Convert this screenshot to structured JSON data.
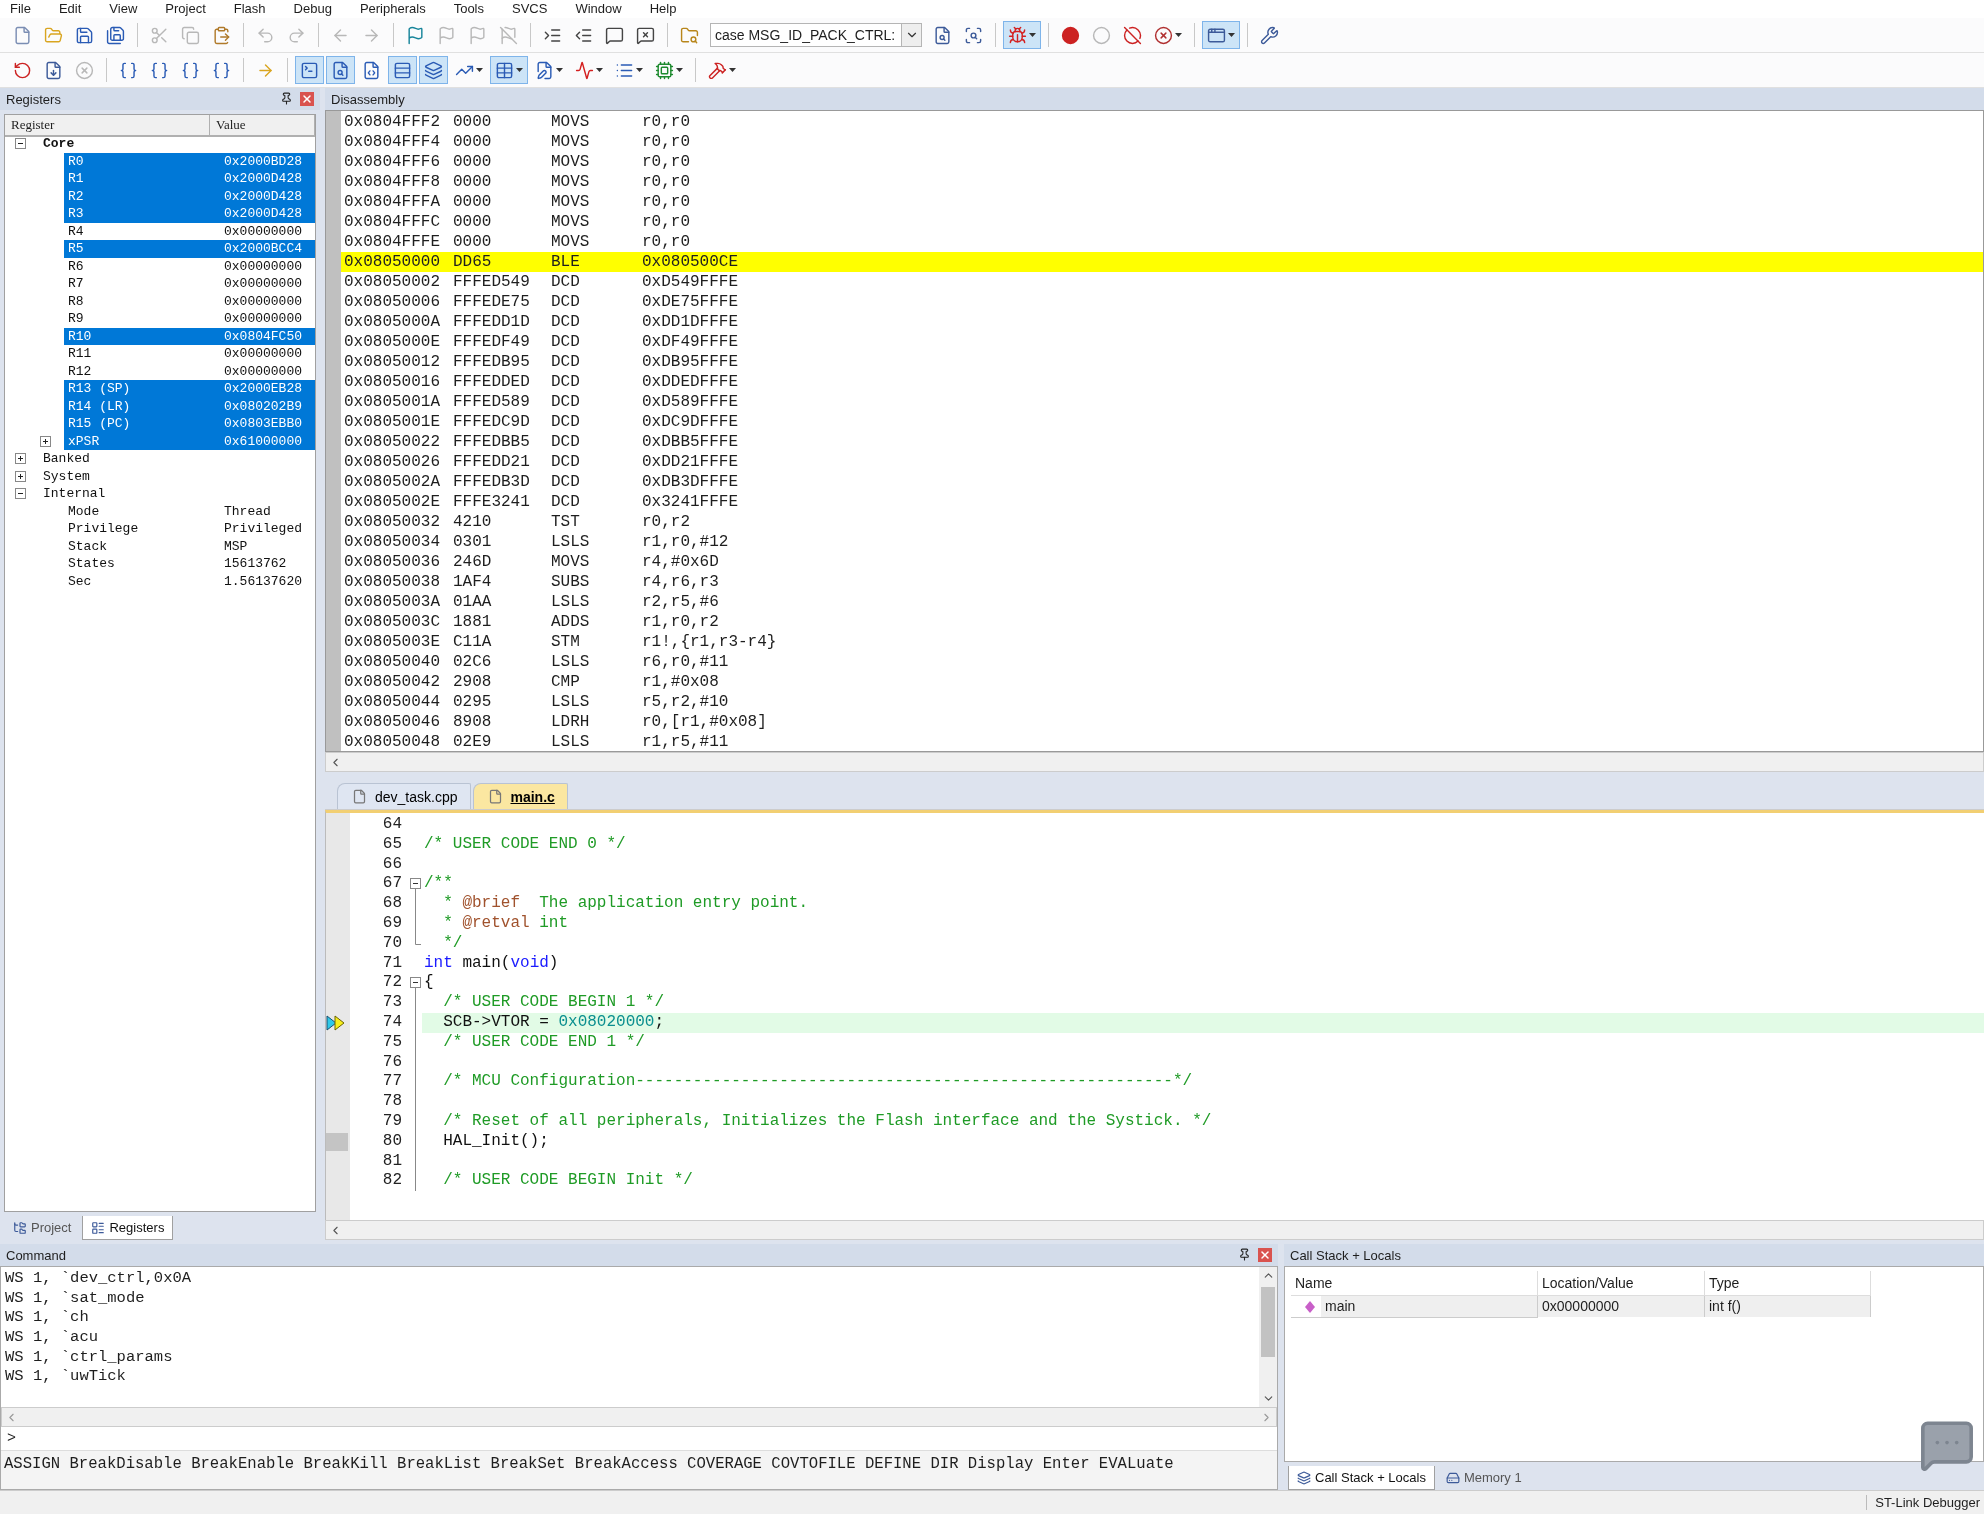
{
  "menu": [
    "File",
    "Edit",
    "View",
    "Project",
    "Flash",
    "Debug",
    "Peripherals",
    "Tools",
    "SVCS",
    "Window",
    "Help"
  ],
  "toolbars": [
    [
      {
        "kind": "newfile",
        "on": false,
        "disabled": false
      },
      {
        "kind": "open",
        "on": false,
        "disabled": false
      },
      {
        "kind": "save",
        "on": false,
        "disabled": false
      },
      {
        "kind": "saveall",
        "on": false,
        "disabled": false
      },
      {
        "kind": "separator"
      },
      {
        "kind": "cut",
        "on": false,
        "disabled": true
      },
      {
        "kind": "copy",
        "on": false,
        "disabled": true
      },
      {
        "kind": "paste",
        "on": false,
        "disabled": false
      },
      {
        "kind": "separator"
      },
      {
        "kind": "undo",
        "on": false,
        "disabled": true
      },
      {
        "kind": "redo",
        "on": false,
        "disabled": true
      },
      {
        "kind": "separator"
      },
      {
        "kind": "back",
        "on": false,
        "disabled": true
      },
      {
        "kind": "forward",
        "on": false,
        "disabled": true
      },
      {
        "kind": "separator"
      },
      {
        "kind": "bookmark",
        "on": false,
        "disabled": false
      },
      {
        "kind": "prevbookmark",
        "on": false,
        "disabled": true
      },
      {
        "kind": "nextbookmark",
        "on": false,
        "disabled": true
      },
      {
        "kind": "clearbookmarks",
        "on": false,
        "disabled": true
      },
      {
        "kind": "separator"
      },
      {
        "kind": "indent",
        "on": false,
        "disabled": false
      },
      {
        "kind": "unindent",
        "on": false,
        "disabled": false
      },
      {
        "kind": "comment",
        "on": false,
        "disabled": false
      },
      {
        "kind": "uncomment",
        "on": false,
        "disabled": false
      },
      {
        "kind": "separator"
      },
      {
        "kind": "findinfiles",
        "on": false,
        "disabled": false
      },
      {
        "kind": "combo",
        "value": "case MSG_ID_PACK_CTRL:"
      },
      {
        "kind": "find",
        "on": false,
        "disabled": false
      },
      {
        "kind": "incfind",
        "on": false,
        "disabled": false
      },
      {
        "kind": "separator"
      },
      {
        "kind": "debug",
        "on": true,
        "disabled": false,
        "dropdown": true
      },
      {
        "kind": "separator"
      },
      {
        "kind": "breakpoint",
        "on": false,
        "disabled": false
      },
      {
        "kind": "enablebp",
        "on": false,
        "disabled": true
      },
      {
        "kind": "disablebp",
        "on": false,
        "disabled": false
      },
      {
        "kind": "killbp",
        "on": false,
        "disabled": false,
        "dropdown": true
      },
      {
        "kind": "separator"
      },
      {
        "kind": "windows",
        "on": true,
        "disabled": false,
        "dropdown": true
      },
      {
        "kind": "separator"
      },
      {
        "kind": "configure",
        "on": false,
        "disabled": false
      }
    ],
    [
      {
        "kind": "reset",
        "on": false,
        "disabled": false
      },
      {
        "kind": "run",
        "on": false,
        "disabled": false
      },
      {
        "kind": "stop",
        "on": false,
        "disabled": true
      },
      {
        "kind": "separator"
      },
      {
        "kind": "stepinto",
        "on": false,
        "disabled": false
      },
      {
        "kind": "stepover",
        "on": false,
        "disabled": false
      },
      {
        "kind": "stepout",
        "on": false,
        "disabled": false
      },
      {
        "kind": "runtocursor",
        "on": false,
        "disabled": false
      },
      {
        "kind": "separator"
      },
      {
        "kind": "shownext",
        "on": false,
        "disabled": false
      },
      {
        "kind": "separator"
      },
      {
        "kind": "commandwin",
        "on": true,
        "disabled": false
      },
      {
        "kind": "disasmwin",
        "on": true,
        "disabled": false
      },
      {
        "kind": "symbols",
        "on": false,
        "disabled": false
      },
      {
        "kind": "registerswin",
        "on": true,
        "disabled": false
      },
      {
        "kind": "callstackwin",
        "on": true,
        "disabled": false
      },
      {
        "kind": "watch",
        "on": false,
        "disabled": false,
        "dropdown": true
      },
      {
        "kind": "memory",
        "on": true,
        "disabled": false,
        "dropdown": true
      },
      {
        "kind": "serial",
        "on": false,
        "disabled": false,
        "dropdown": true
      },
      {
        "kind": "analysis",
        "on": false,
        "disabled": false,
        "dropdown": true
      },
      {
        "kind": "trace",
        "on": false,
        "disabled": false,
        "dropdown": true
      },
      {
        "kind": "sysviewer",
        "on": false,
        "disabled": false,
        "dropdown": true
      },
      {
        "kind": "separator"
      },
      {
        "kind": "toolbox",
        "on": false,
        "disabled": false,
        "dropdown": true
      }
    ]
  ],
  "registers": {
    "title": "Registers",
    "columns": [
      "Register",
      "Value"
    ],
    "tree": [
      {
        "name": "Core",
        "bold": true,
        "expanded": true,
        "selected": false,
        "children": [
          {
            "name": "R0",
            "value": "0x2000BD28",
            "selected": true
          },
          {
            "name": "R1",
            "value": "0x2000D428",
            "selected": true
          },
          {
            "name": "R2",
            "value": "0x2000D428",
            "selected": true
          },
          {
            "name": "R3",
            "value": "0x2000D428",
            "selected": true
          },
          {
            "name": "R4",
            "value": "0x00000000",
            "selected": false
          },
          {
            "name": "R5",
            "value": "0x2000BCC4",
            "selected": true
          },
          {
            "name": "R6",
            "value": "0x00000000",
            "selected": false
          },
          {
            "name": "R7",
            "value": "0x00000000",
            "selected": false
          },
          {
            "name": "R8",
            "value": "0x00000000",
            "selected": false
          },
          {
            "name": "R9",
            "value": "0x00000000",
            "selected": false
          },
          {
            "name": "R10",
            "value": "0x0804FC50",
            "selected": true
          },
          {
            "name": "R11",
            "value": "0x00000000",
            "selected": false
          },
          {
            "name": "R12",
            "value": "0x00000000",
            "selected": false
          },
          {
            "name": "R13 (SP)",
            "value": "0x2000EB28",
            "selected": true
          },
          {
            "name": "R14 (LR)",
            "value": "0x080202B9",
            "selected": true
          },
          {
            "name": "R15 (PC)",
            "value": "0x0803EBB0",
            "selected": true
          },
          {
            "name": "xPSR",
            "value": "0x61000000",
            "selected": true,
            "expanded": false
          }
        ]
      },
      {
        "name": "Banked",
        "bold": false,
        "expanded": false,
        "selected": false
      },
      {
        "name": "System",
        "bold": false,
        "expanded": false,
        "selected": false
      },
      {
        "name": "Internal",
        "bold": false,
        "expanded": true,
        "selected": false,
        "children": [
          {
            "name": "Mode",
            "value": "Thread",
            "selected": false
          },
          {
            "name": "Privilege",
            "value": "Privileged",
            "selected": false
          },
          {
            "name": "Stack",
            "value": "MSP",
            "selected": false
          },
          {
            "name": "States",
            "value": "15613762",
            "selected": false
          },
          {
            "name": "Sec",
            "value": "1.56137620",
            "selected": false
          }
        ]
      }
    ]
  },
  "left_tabs": [
    {
      "label": "Project",
      "selected": false
    },
    {
      "label": "Registers",
      "selected": true
    }
  ],
  "disassembly": {
    "title": "Disassembly",
    "rows": [
      {
        "address": "0x0804FFF2",
        "opcode": "0000",
        "mnemonic": "MOVS",
        "operands": "r0,r0",
        "selected": false
      },
      {
        "address": "0x0804FFF4",
        "opcode": "0000",
        "mnemonic": "MOVS",
        "operands": "r0,r0",
        "selected": false
      },
      {
        "address": "0x0804FFF6",
        "opcode": "0000",
        "mnemonic": "MOVS",
        "operands": "r0,r0",
        "selected": false
      },
      {
        "address": "0x0804FFF8",
        "opcode": "0000",
        "mnemonic": "MOVS",
        "operands": "r0,r0",
        "selected": false
      },
      {
        "address": "0x0804FFFA",
        "opcode": "0000",
        "mnemonic": "MOVS",
        "operands": "r0,r0",
        "selected": false
      },
      {
        "address": "0x0804FFFC",
        "opcode": "0000",
        "mnemonic": "MOVS",
        "operands": "r0,r0",
        "selected": false
      },
      {
        "address": "0x0804FFFE",
        "opcode": "0000",
        "mnemonic": "MOVS",
        "operands": "r0,r0",
        "selected": false
      },
      {
        "address": "0x08050000",
        "opcode": "DD65",
        "mnemonic": "BLE",
        "operands": "0x080500CE",
        "selected": true
      },
      {
        "address": "0x08050002",
        "opcode": "FFFED549",
        "mnemonic": "DCD",
        "operands": "0xD549FFFE",
        "selected": false
      },
      {
        "address": "0x08050006",
        "opcode": "FFFEDE75",
        "mnemonic": "DCD",
        "operands": "0xDE75FFFE",
        "selected": false
      },
      {
        "address": "0x0805000A",
        "opcode": "FFFEDD1D",
        "mnemonic": "DCD",
        "operands": "0xDD1DFFFE",
        "selected": false
      },
      {
        "address": "0x0805000E",
        "opcode": "FFFEDF49",
        "mnemonic": "DCD",
        "operands": "0xDF49FFFE",
        "selected": false
      },
      {
        "address": "0x08050012",
        "opcode": "FFFEDB95",
        "mnemonic": "DCD",
        "operands": "0xDB95FFFE",
        "selected": false
      },
      {
        "address": "0x08050016",
        "opcode": "FFFEDDED",
        "mnemonic": "DCD",
        "operands": "0xDDEDFFFE",
        "selected": false
      },
      {
        "address": "0x0805001A",
        "opcode": "FFFED589",
        "mnemonic": "DCD",
        "operands": "0xD589FFFE",
        "selected": false
      },
      {
        "address": "0x0805001E",
        "opcode": "FFFEDC9D",
        "mnemonic": "DCD",
        "operands": "0xDC9DFFFE",
        "selected": false
      },
      {
        "address": "0x08050022",
        "opcode": "FFFEDBB5",
        "mnemonic": "DCD",
        "operands": "0xDBB5FFFE",
        "selected": false
      },
      {
        "address": "0x08050026",
        "opcode": "FFFEDD21",
        "mnemonic": "DCD",
        "operands": "0xDD21FFFE",
        "selected": false
      },
      {
        "address": "0x0805002A",
        "opcode": "FFFEDB3D",
        "mnemonic": "DCD",
        "operands": "0xDB3DFFFE",
        "selected": false
      },
      {
        "address": "0x0805002E",
        "opcode": "FFFE3241",
        "mnemonic": "DCD",
        "operands": "0x3241FFFE",
        "selected": false
      },
      {
        "address": "0x08050032",
        "opcode": "4210",
        "mnemonic": "TST",
        "operands": "r0,r2",
        "selected": false
      },
      {
        "address": "0x08050034",
        "opcode": "0301",
        "mnemonic": "LSLS",
        "operands": "r1,r0,#12",
        "selected": false
      },
      {
        "address": "0x08050036",
        "opcode": "246D",
        "mnemonic": "MOVS",
        "operands": "r4,#0x6D",
        "selected": false
      },
      {
        "address": "0x08050038",
        "opcode": "1AF4",
        "mnemonic": "SUBS",
        "operands": "r4,r6,r3",
        "selected": false
      },
      {
        "address": "0x0805003A",
        "opcode": "01AA",
        "mnemonic": "LSLS",
        "operands": "r2,r5,#6",
        "selected": false
      },
      {
        "address": "0x0805003C",
        "opcode": "1881",
        "mnemonic": "ADDS",
        "operands": "r1,r0,r2",
        "selected": false
      },
      {
        "address": "0x0805003E",
        "opcode": "C11A",
        "mnemonic": "STM",
        "operands": "r1!,{r1,r3-r4}",
        "selected": false
      },
      {
        "address": "0x08050040",
        "opcode": "02C6",
        "mnemonic": "LSLS",
        "operands": "r6,r0,#11",
        "selected": false
      },
      {
        "address": "0x08050042",
        "opcode": "2908",
        "mnemonic": "CMP",
        "operands": "r1,#0x08",
        "selected": false
      },
      {
        "address": "0x08050044",
        "opcode": "0295",
        "mnemonic": "LSLS",
        "operands": "r5,r2,#10",
        "selected": false
      },
      {
        "address": "0x08050046",
        "opcode": "8908",
        "mnemonic": "LDRH",
        "operands": "r0,[r1,#0x08]",
        "selected": false
      },
      {
        "address": "0x08050048",
        "opcode": "02E9",
        "mnemonic": "LSLS",
        "operands": "r1,r5,#11",
        "selected": false
      }
    ]
  },
  "editor": {
    "tabs": [
      {
        "label": "dev_task.cpp",
        "selected": false
      },
      {
        "label": "main.c",
        "selected": true
      }
    ],
    "lines": [
      {
        "number": "64",
        "current": false,
        "code": false,
        "fold_start": false,
        "fold_line": false,
        "fold_end": false
      },
      {
        "number": "65",
        "current": false,
        "code": false,
        "fold_start": false,
        "fold_line": false,
        "fold_end": false,
        "segments": [
          {
            "kind": "comment",
            "text": "/* USER CODE END 0 */"
          }
        ]
      },
      {
        "number": "66",
        "current": false,
        "code": false,
        "fold_start": false,
        "fold_line": false,
        "fold_end": false
      },
      {
        "number": "67",
        "current": false,
        "code": false,
        "fold_start": true,
        "fold_line": false,
        "fold_end": false,
        "segments": [
          {
            "kind": "comment",
            "text": "/**"
          }
        ]
      },
      {
        "number": "68",
        "current": false,
        "code": false,
        "fold_start": false,
        "fold_line": true,
        "fold_end": false,
        "segments": [
          {
            "kind": "comment",
            "text": "  * "
          },
          {
            "kind": "tag",
            "text": "@brief"
          },
          {
            "kind": "comment",
            "text": "  The application entry point."
          }
        ]
      },
      {
        "number": "69",
        "current": false,
        "code": false,
        "fold_start": false,
        "fold_line": true,
        "fold_end": false,
        "segments": [
          {
            "kind": "comment",
            "text": "  * "
          },
          {
            "kind": "tag",
            "text": "@retval"
          },
          {
            "kind": "comment",
            "text": " int"
          }
        ]
      },
      {
        "number": "70",
        "current": false,
        "code": false,
        "fold_start": false,
        "fold_line": false,
        "fold_end": true,
        "segments": [
          {
            "kind": "comment",
            "text": "  */"
          }
        ]
      },
      {
        "number": "71",
        "current": false,
        "code": false,
        "fold_start": false,
        "fold_line": false,
        "fold_end": false,
        "segments": [
          {
            "kind": "keyword",
            "text": "int"
          },
          {
            "kind": "plain",
            "text": " main("
          },
          {
            "kind": "keyword",
            "text": "void"
          },
          {
            "kind": "plain",
            "text": ")"
          }
        ]
      },
      {
        "number": "72",
        "current": false,
        "code": false,
        "fold_start": true,
        "fold_line": false,
        "fold_end": false,
        "segments": [
          {
            "kind": "plain",
            "text": "{"
          }
        ]
      },
      {
        "number": "73",
        "current": false,
        "code": false,
        "fold_start": false,
        "fold_line": true,
        "fold_end": false,
        "segments": [
          {
            "kind": "comment",
            "text": "  /* USER CODE BEGIN 1 */"
          }
        ]
      },
      {
        "number": "74",
        "current": true,
        "code": false,
        "fold_start": false,
        "fold_line": true,
        "fold_end": false,
        "segments": [
          {
            "kind": "plain",
            "text": "  SCB->VTOR = "
          },
          {
            "kind": "number",
            "text": "0x08020000"
          },
          {
            "kind": "plain",
            "text": ";"
          }
        ]
      },
      {
        "number": "75",
        "current": false,
        "code": false,
        "fold_start": false,
        "fold_line": true,
        "fold_end": false,
        "segments": [
          {
            "kind": "comment",
            "text": "  /* USER CODE END 1 */"
          }
        ]
      },
      {
        "number": "76",
        "current": false,
        "code": false,
        "fold_start": false,
        "fold_line": true,
        "fold_end": false
      },
      {
        "number": "77",
        "current": false,
        "code": false,
        "fold_start": false,
        "fold_line": true,
        "fold_end": false,
        "segments": [
          {
            "kind": "comment",
            "text": "  /* MCU Configuration--------------------------------------------------------*/"
          }
        ]
      },
      {
        "number": "78",
        "current": false,
        "code": false,
        "fold_start": false,
        "fold_line": true,
        "fold_end": false
      },
      {
        "number": "79",
        "current": false,
        "code": false,
        "fold_start": false,
        "fold_line": true,
        "fold_end": false,
        "segments": [
          {
            "kind": "comment",
            "text": "  /* Reset of all peripherals, Initializes the Flash interface and the Systick. */"
          }
        ]
      },
      {
        "number": "80",
        "current": false,
        "code": true,
        "fold_start": false,
        "fold_line": true,
        "fold_end": false,
        "segments": [
          {
            "kind": "plain",
            "text": "  HAL_Init();"
          }
        ]
      },
      {
        "number": "81",
        "current": false,
        "code": false,
        "fold_start": false,
        "fold_line": true,
        "fold_end": false
      },
      {
        "number": "82",
        "current": false,
        "code": false,
        "fold_start": false,
        "fold_line": true,
        "fold_end": false,
        "segments": [
          {
            "kind": "comment",
            "text": "  /* USER CODE BEGIN Init */"
          }
        ]
      }
    ]
  },
  "command": {
    "title": "Command",
    "lines": [
      "WS 1, `dev_ctrl,0x0A",
      "WS 1, `sat_mode",
      "WS 1, `ch",
      "WS 1, `acu",
      "WS 1, `ctrl_params",
      "WS 1, `uwTick"
    ],
    "prompt": ">",
    "hint": "ASSIGN BreakDisable BreakEnable BreakKill BreakList BreakSet BreakAccess COVERAGE COVTOFILE DEFINE DIR Display Enter EVALuate"
  },
  "callstack": {
    "title": "Call Stack + Locals",
    "columns": [
      "Name",
      "Location/Value",
      "Type"
    ],
    "rows": [
      {
        "name": "main",
        "value": "0x00000000",
        "type": "int f()"
      }
    ]
  },
  "right_tabs": [
    {
      "label": "Call Stack + Locals",
      "selected": true
    },
    {
      "label": "Memory 1",
      "selected": false
    }
  ],
  "status_bar": {
    "text": "ST-Link Debugger"
  }
}
